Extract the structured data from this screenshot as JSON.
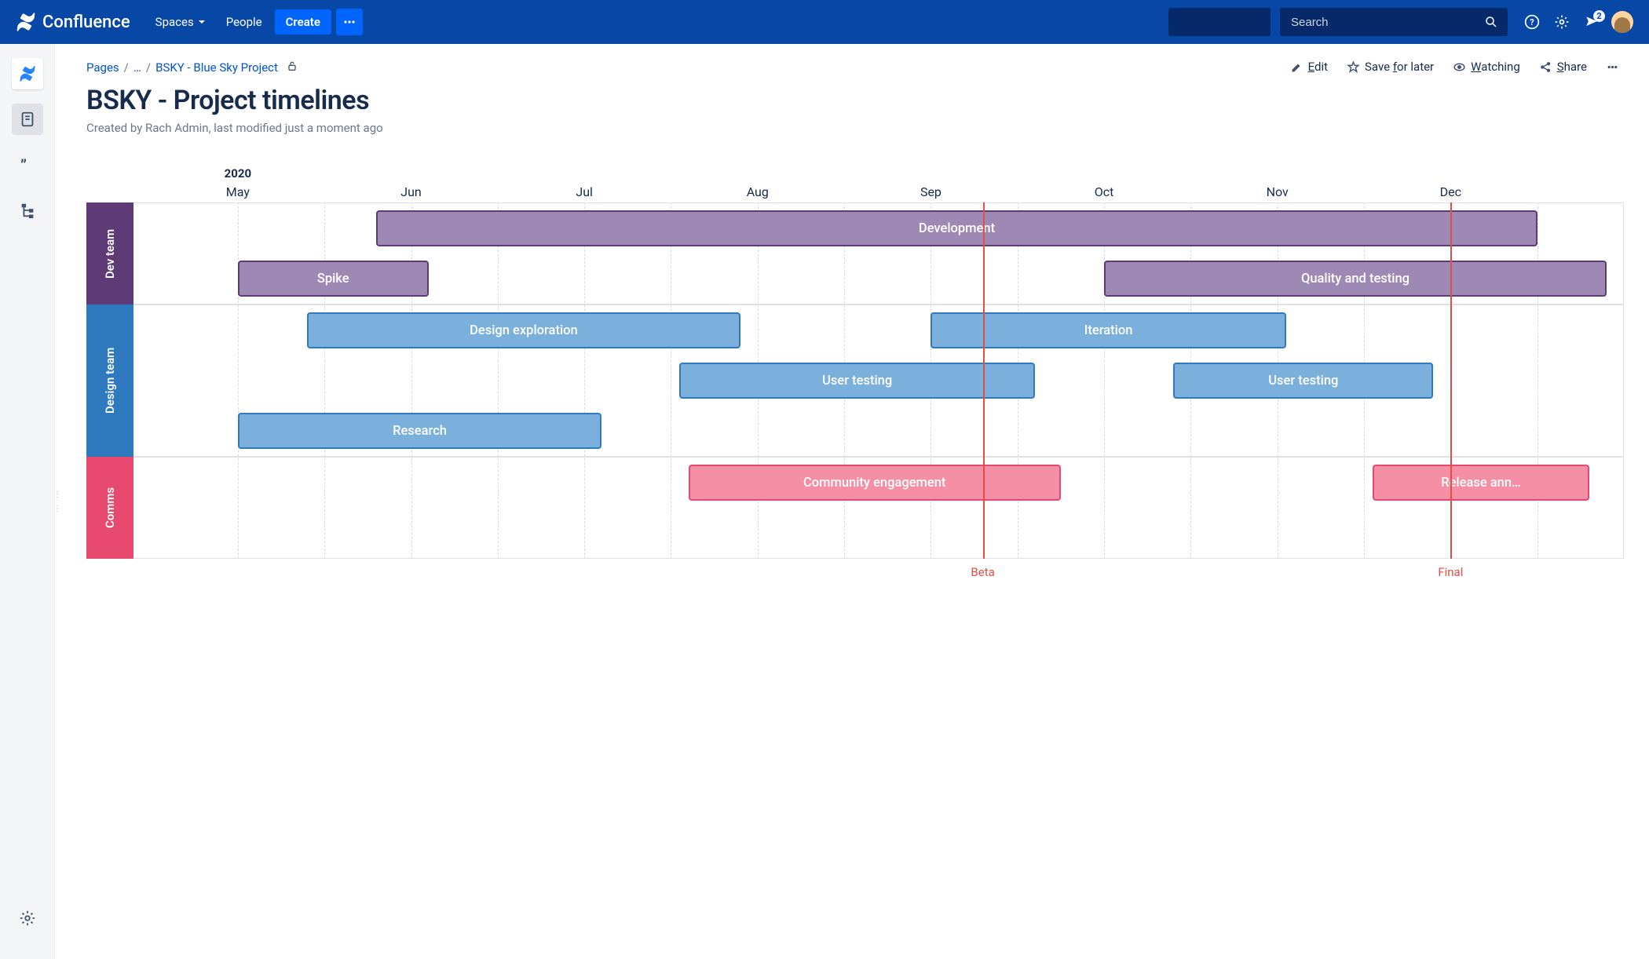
{
  "brand": "Confluence",
  "nav": {
    "spaces": "Spaces",
    "people": "People",
    "create": "Create"
  },
  "search": {
    "placeholder": "Search"
  },
  "notifications": {
    "count": "2"
  },
  "breadcrumb": {
    "pages": "Pages",
    "ellipsis": "…",
    "parent": "BSKY - Blue Sky Project"
  },
  "page_actions": {
    "edit_pre": "E",
    "edit_ul": "dit",
    "save_pre": "Save ",
    "save_ul": "f",
    "save_post": "or later",
    "watch_ul": "W",
    "watch_post": "atching",
    "share_ul": "S",
    "share_post": "hare"
  },
  "page": {
    "title": "BSKY - Project timelines",
    "byline": "Created by Rach Admin, last modified just a moment ago"
  },
  "chart_data": {
    "type": "gantt",
    "year": "2020",
    "months": [
      "May",
      "Jun",
      "Jul",
      "Aug",
      "Sep",
      "Oct",
      "Nov",
      "Dec"
    ],
    "month_unit_pct": 12.5,
    "lanes": [
      {
        "name": "Dev team",
        "color": "purple",
        "tracks": [
          [
            {
              "label": "Development",
              "start": 0.8,
              "end": 7.5
            }
          ],
          [
            {
              "label": "Spike",
              "start": 0.0,
              "end": 1.1
            },
            {
              "label": "Quality and testing",
              "start": 5.0,
              "end": 7.9
            }
          ]
        ]
      },
      {
        "name": "Design team",
        "color": "blue",
        "tracks": [
          [
            {
              "label": "Design exploration",
              "start": 0.4,
              "end": 2.9
            },
            {
              "label": "Iteration",
              "start": 4.0,
              "end": 6.05
            }
          ],
          [
            {
              "label": "User testing",
              "start": 2.55,
              "end": 4.6
            },
            {
              "label": "User testing",
              "start": 5.4,
              "end": 6.9
            }
          ],
          [
            {
              "label": "Research",
              "start": 0.0,
              "end": 2.1
            }
          ]
        ]
      },
      {
        "name": "Comms",
        "color": "pink",
        "tracks": [
          [
            {
              "label": "Community engagement",
              "start": 2.6,
              "end": 4.75
            },
            {
              "label": "Release ann…",
              "start": 6.55,
              "end": 7.8
            }
          ],
          []
        ]
      }
    ],
    "milestones": [
      {
        "label": "Beta",
        "at": 4.3
      },
      {
        "label": "Final",
        "at": 7.0
      }
    ]
  }
}
